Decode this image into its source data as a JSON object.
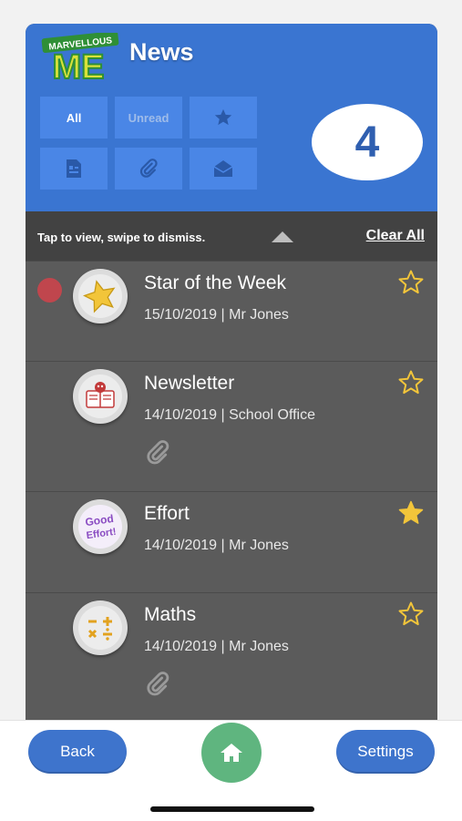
{
  "header": {
    "logo_text_top": "MARVELLOUS",
    "logo_text_main": "ME",
    "title": "News",
    "filters": {
      "all": "All",
      "unread": "Unread",
      "starred_icon": "star-icon",
      "document_icon": "document-icon",
      "attachment_icon": "paperclip-icon",
      "open_mail_icon": "open-envelope-icon"
    },
    "count": "4"
  },
  "hint_bar": {
    "hint": "Tap to view, swipe to dismiss.",
    "clear_all": "Clear All"
  },
  "items": [
    {
      "title": "Star of the Week",
      "meta": "15/10/2019 | Mr Jones",
      "unread": true,
      "starred": false,
      "attachment": false,
      "badge": "gold-star"
    },
    {
      "title": "Newsletter",
      "meta": "14/10/2019 | School Office",
      "unread": false,
      "starred": false,
      "attachment": true,
      "badge": "newsletter"
    },
    {
      "title": "Effort",
      "meta": "14/10/2019 | Mr Jones",
      "unread": false,
      "starred": true,
      "attachment": false,
      "badge": "good-effort",
      "badge_text_1": "Good",
      "badge_text_2": "Effort!"
    },
    {
      "title": "Maths",
      "meta": "14/10/2019 | Mr Jones",
      "unread": false,
      "starred": false,
      "attachment": true,
      "badge": "maths"
    }
  ],
  "bottom_bar": {
    "back": "Back",
    "settings": "Settings",
    "home_icon": "home-icon"
  },
  "colors": {
    "header_blue": "#3a75d1",
    "list_gray": "#5b5b5b",
    "star_yellow": "#f2c53a",
    "unread_red": "#c0464d",
    "home_green": "#5fb57f"
  }
}
